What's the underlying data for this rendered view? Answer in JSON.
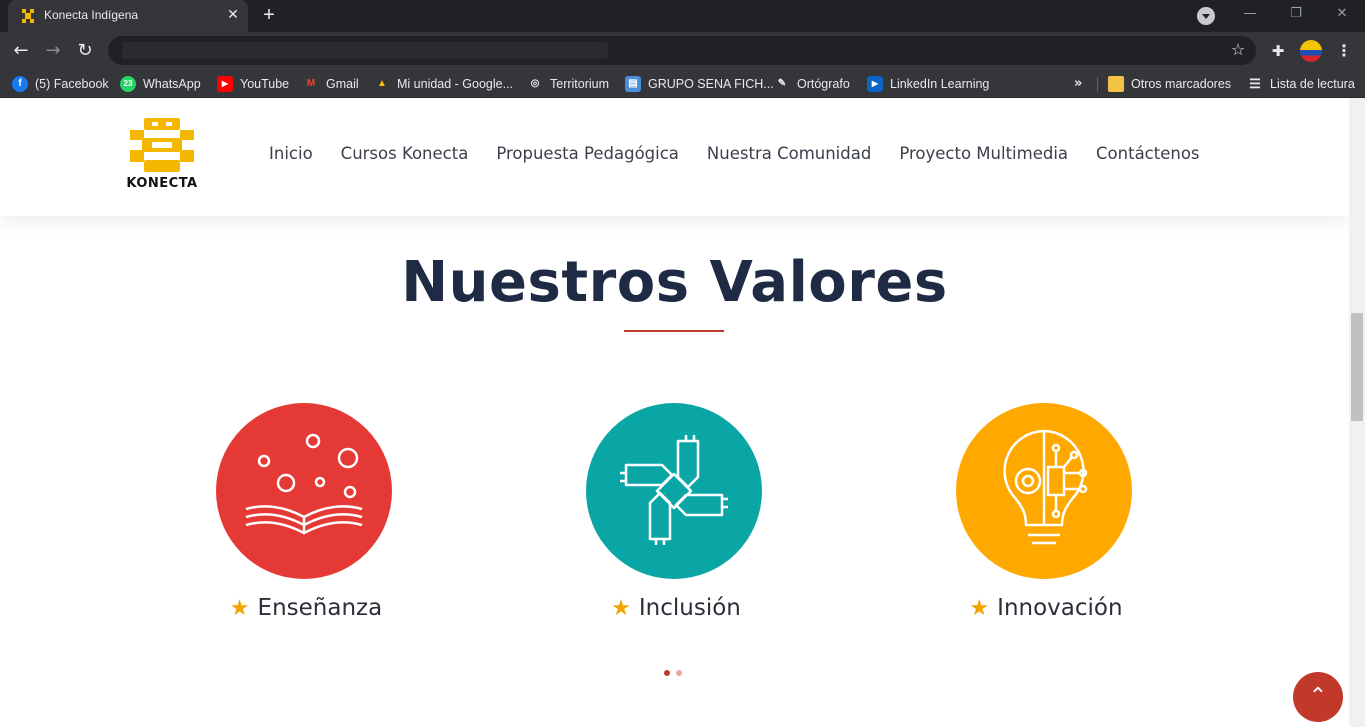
{
  "browser": {
    "tab_title": "Konecta Indígena",
    "tab_close": "✕",
    "new_tab": "+",
    "window_controls": [
      "—",
      "❐",
      "✕"
    ],
    "bookmarks": [
      {
        "label": "(5) Facebook",
        "icon": "facebook-icon",
        "color": "#1877f2",
        "glyph": "f"
      },
      {
        "label": "WhatsApp",
        "icon": "whatsapp-icon",
        "color": "#25d366",
        "glyph": "23"
      },
      {
        "label": "YouTube",
        "icon": "youtube-icon",
        "color": "#ff0000",
        "glyph": "▶"
      },
      {
        "label": "Gmail",
        "icon": "gmail-icon",
        "color": "#ea4335",
        "glyph": "M"
      },
      {
        "label": "Mi unidad - Google...",
        "icon": "google-drive-icon",
        "color": "#1fa463",
        "glyph": "▲"
      },
      {
        "label": "Territorium",
        "icon": "territorium-icon",
        "color": "#3c4043",
        "glyph": "◎"
      },
      {
        "label": "GRUPO SENA FICH...",
        "icon": "sena-icon",
        "color": "#4a8fd8",
        "glyph": "▤"
      },
      {
        "label": "Ortógrafo",
        "icon": "ortografo-icon",
        "color": "#3c4043",
        "glyph": "✎"
      },
      {
        "label": "LinkedIn Learning",
        "icon": "linkedin-learning-icon",
        "color": "#0a66c2",
        "glyph": "▶"
      }
    ],
    "bookmarks_more": "»",
    "other_bookmarks": "Otros marcadores",
    "reading_list": "Lista de lectura"
  },
  "site": {
    "logo_text": "KONECTA",
    "nav": [
      "Inicio",
      "Cursos Konecta",
      "Propuesta Pedagógica",
      "Nuestra Comunidad",
      "Proyecto Multimedia",
      "Contáctenos"
    ]
  },
  "section": {
    "title": "Nuestros Valores",
    "accent": "#c0392b",
    "values": [
      {
        "label": "Enseñanza",
        "icon": "open-book-icon",
        "color": "#e53935"
      },
      {
        "label": "Inclusión",
        "icon": "joined-hands-icon",
        "color": "#0aa5a5"
      },
      {
        "label": "Innovación",
        "icon": "lightbulb-circuit-icon",
        "color": "#ffa800"
      }
    ],
    "carousel": {
      "pages": 2,
      "active": 1
    }
  },
  "back_to_top": "⌃"
}
